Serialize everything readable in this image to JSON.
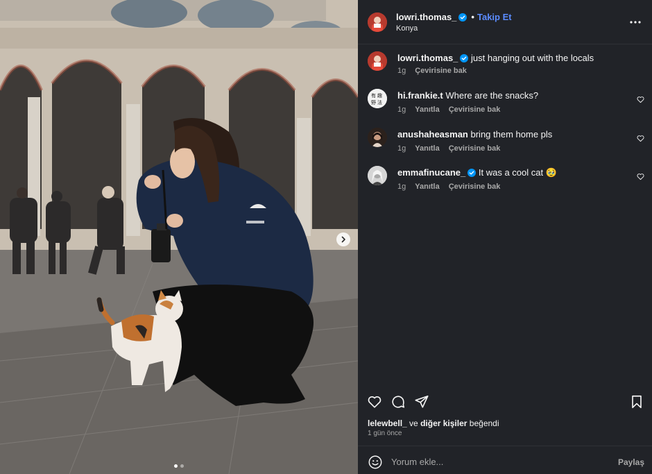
{
  "post": {
    "author": "lowri.thomas_",
    "follow_label": "Takip Et",
    "separator": "•",
    "location": "Konya",
    "caption": {
      "user": "lowri.thomas_",
      "text": "just hanging out with the locals",
      "age": "1g",
      "translate_label": "Çevirisine bak"
    },
    "media": {
      "carousel_index": 1,
      "carousel_total": 2,
      "next_icon": "chevron-right-icon"
    }
  },
  "comments": [
    {
      "user": "hi.frankie.t",
      "verified": false,
      "text": "Where are the snacks?",
      "age": "1g",
      "reply_label": "Yanıtla",
      "translate_label": "Çevirisine bak"
    },
    {
      "user": "anushaheasman",
      "verified": false,
      "text": "bring them home pls",
      "age": "1g",
      "reply_label": "Yanıtla",
      "translate_label": "Çevirisine bak"
    },
    {
      "user": "emmafinucane_",
      "verified": true,
      "text": "It was a cool cat 🥹",
      "age": "1g",
      "reply_label": "Yanıtla",
      "translate_label": "Çevirisine bak"
    }
  ],
  "actions": {
    "icons": [
      "heart-icon",
      "comment-icon",
      "share-icon",
      "bookmark-icon"
    ]
  },
  "likes": {
    "user": "lelewbell_",
    "connector": "ve",
    "others": "diğer kişiler",
    "suffix": "beğendi"
  },
  "timestamp": "1 gün önce",
  "composer": {
    "placeholder": "Yorum ekle...",
    "share_label": "Paylaş"
  },
  "colors": {
    "panel_bg": "#212328",
    "accent_blue": "#5b8cff",
    "verified_blue": "#0095f6",
    "muted_text": "#a8a8a8"
  }
}
